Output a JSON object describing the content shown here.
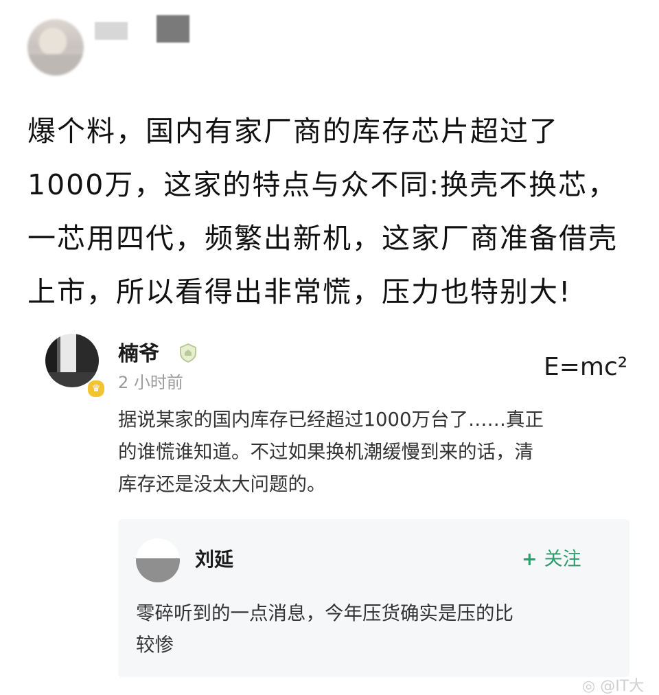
{
  "post": {
    "lines": [
      "爆个料，国内有家厂商的库存芯片超过了",
      "1000万，这家的特点与众不同:换壳不换芯，",
      "一芯用四代，频繁出新机，这家厂商准备借壳",
      "上市，所以看得出非常慌，压力也特别大!"
    ]
  },
  "comment": {
    "author": "楠爷",
    "time": "2 小时前",
    "formula": "E=mc²",
    "lines": [
      "据说某家的国内库存已经超过1000万台了……真正",
      "的谁慌谁知道。不过如果换机潮缓慢到来的话，清",
      "库存还是没太大问题的。"
    ]
  },
  "reply": {
    "author": "刘延",
    "follow_label": "关注",
    "follow_symbol": "+",
    "lines": [
      "零碎听到的一点消息，今年压货确实是压的比",
      "较惨"
    ]
  },
  "watermark": "@IT大",
  "colors": {
    "follow": "#2e9d6b",
    "badge": "#f4c430",
    "time": "#9a9a9a"
  },
  "icons": {
    "level_badge": "shield-badge-icon",
    "verify_badge": "crown-badge-icon",
    "watermark": "weibo-icon"
  }
}
